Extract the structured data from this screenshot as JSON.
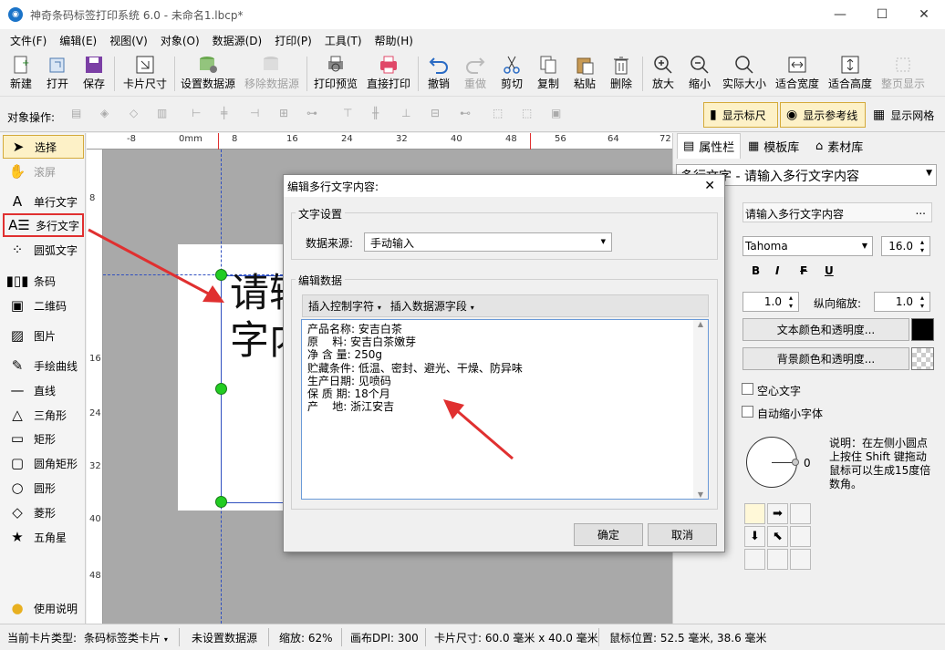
{
  "window": {
    "title": "神奇条码标签打印系统 6.0 - 未命名1.lbcp*",
    "app_icon": "app-logo-icon"
  },
  "menu": [
    "文件(F)",
    "编辑(E)",
    "视图(V)",
    "对象(O)",
    "数据源(D)",
    "打印(P)",
    "工具(T)",
    "帮助(H)"
  ],
  "toolbar": {
    "new": "新建",
    "open": "打开",
    "save": "保存",
    "card_size": "卡片尺寸",
    "set_datasource": "设置数据源",
    "remove_datasource": "移除数据源",
    "print_preview": "打印预览",
    "print": "直接打印",
    "undo": "撤销",
    "redo": "重做",
    "cut": "剪切",
    "copy": "复制",
    "paste": "粘贴",
    "delete": "删除",
    "zoom_in": "放大",
    "zoom_out": "缩小",
    "actual_size": "实际大小",
    "fit_width": "适合宽度",
    "fit_height": "适合高度",
    "full_page": "整页显示"
  },
  "objbar": {
    "label": "对象操作:",
    "show_ruler": "显示标尺",
    "show_guides": "显示参考线",
    "show_grid": "显示网格"
  },
  "tools": [
    "选择",
    "滚屏",
    "单行文字",
    "多行文字",
    "圆弧文字",
    "条码",
    "二维码",
    "图片",
    "手绘曲线",
    "直线",
    "三角形",
    "矩形",
    "圆角矩形",
    "圆形",
    "菱形",
    "五角星",
    "使用说明"
  ],
  "ruler": {
    "h": [
      "-8",
      "0mm",
      "8",
      "16",
      "24",
      "32",
      "40",
      "48",
      "56",
      "64",
      "72"
    ],
    "v": [
      "8",
      "16",
      "24",
      "32",
      "40",
      "48"
    ]
  },
  "canvas": {
    "text_line1": "请输",
    "text_line2": "字内"
  },
  "rightpanel": {
    "tabs": [
      "属性栏",
      "模板库",
      "素材库"
    ],
    "object_select": "多行文字 - 请输入多行文字内容",
    "content_value": "请输入多行文字内容",
    "more_btn": "...",
    "font": "Tahoma",
    "font_size": "16.0",
    "bold": "B",
    "italic": "I",
    "strike": "F",
    "underline": "U",
    "spacing1": "1.0",
    "vscale_label": "纵向缩放:",
    "vscale": "1.0",
    "text_color_btn": "文本颜色和透明度...",
    "bg_color_btn": "背景颜色和透明度...",
    "hollow": "空心文字",
    "autoshrink": "自动缩小字体",
    "rotate_value": "0",
    "help_text": "说明：在左侧小圆点上按住 Shift 键拖动鼠标可以生成15度倍数角。"
  },
  "dialog": {
    "title": "编辑多行文字内容:",
    "text_settings": "文字设置",
    "datasource_label": "数据来源:",
    "datasource_value": "手动输入",
    "edit_data": "编辑数据",
    "insert_control": "插入控制字符",
    "insert_field": "插入数据源字段",
    "content": "产品名称: 安吉白茶\n原    料: 安吉白茶嫩芽\n净 含 量: 250g\n贮藏条件: 低温、密封、避光、干燥、防异味\n生产日期: 见喷码\n保 质 期: 18个月\n产    地: 浙江安吉",
    "ok": "确定",
    "cancel": "取消"
  },
  "status": {
    "card_type_label": "当前卡片类型:",
    "card_type": "条码标签类卡片",
    "datasource": "未设置数据源",
    "zoom": "缩放: 62%",
    "dpi": "画布DPI: 300",
    "card_size": "卡片尺寸: 60.0 毫米 x 40.0 毫米",
    "mouse": "鼠标位置: 52.5 毫米, 38.6 毫米"
  },
  "colors": {
    "accent": "#e03030",
    "handle": "#22cc22",
    "selection": "#f3c6c6"
  }
}
